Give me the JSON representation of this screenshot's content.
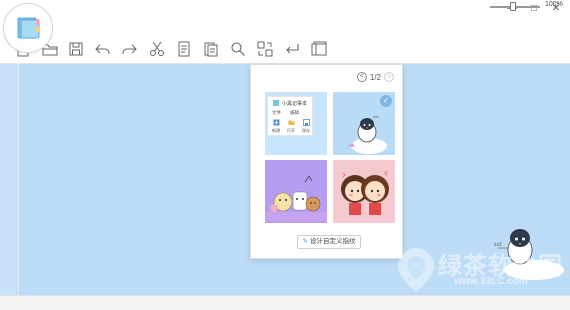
{
  "window": {
    "controls": [
      {
        "name": "minimize-button",
        "glyph": "—"
      },
      {
        "name": "maximize-button",
        "glyph": "□"
      },
      {
        "name": "close-button",
        "glyph": "✕"
      }
    ]
  },
  "toolbar": {
    "icons": [
      "new-file-icon",
      "open-folder-icon",
      "save-icon",
      "undo-icon",
      "redo-icon",
      "cut-icon",
      "copy-icon",
      "paste-icon",
      "search-icon",
      "replace-icon",
      "return-icon",
      "panel-icon"
    ]
  },
  "skin_panel": {
    "page": "1/2",
    "prev_glyph": "<",
    "next_glyph": ">",
    "mini_app": {
      "title": "小黑记事本",
      "menu": [
        "文件",
        "编辑"
      ],
      "buttons": [
        "新建",
        "打开",
        "保存"
      ]
    },
    "design_button": "设计自定义指纹"
  },
  "status": {
    "zoom": "100%"
  },
  "watermark": {
    "text": "绿茶软件园",
    "url": "www.33LC.com"
  },
  "colors": {
    "editor_bg": "#bcdcf7",
    "accent": "#4a90d9"
  }
}
